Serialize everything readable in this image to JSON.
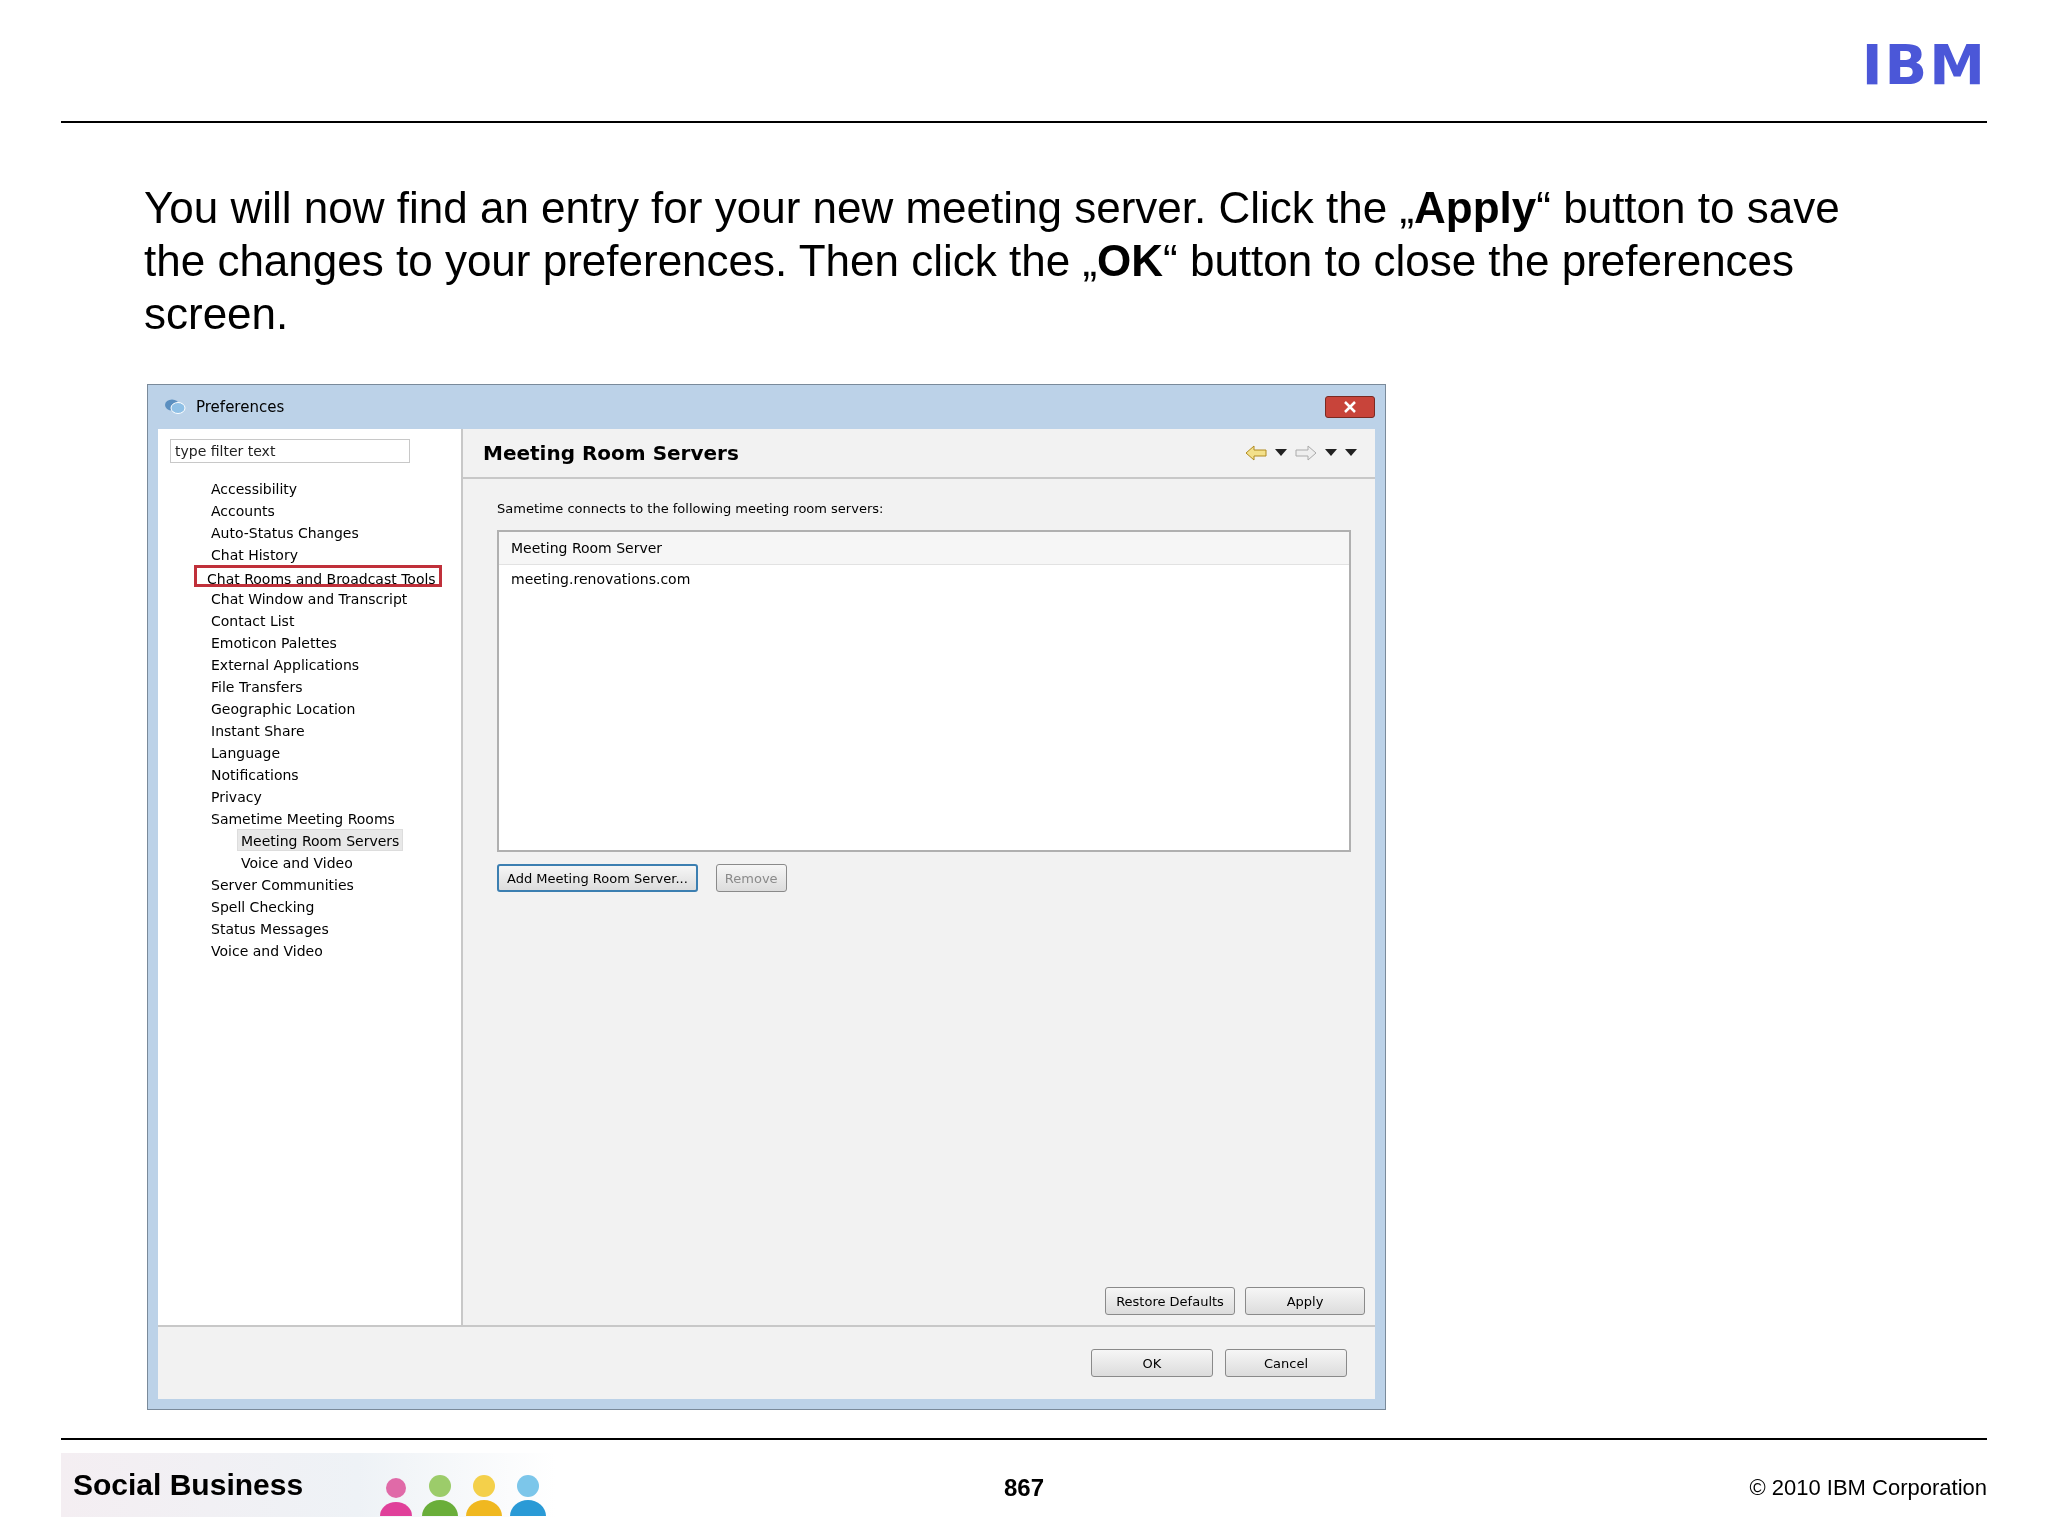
{
  "logo": "IBM",
  "instruction": "You will now find an entry for your new meeting server. Click the „**Apply**“ button to save the changes to your preferences. Then click the „**OK**“ button to close the preferences screen.",
  "dialog": {
    "title": "Preferences",
    "filter": {
      "placeholder": "type filter text"
    },
    "tree": [
      {
        "label": "Accessibility",
        "selected": false,
        "annotated": false
      },
      {
        "label": "Accounts",
        "selected": false,
        "annotated": false
      },
      {
        "label": "Auto-Status Changes",
        "selected": false,
        "annotated": false
      },
      {
        "label": "Chat History",
        "selected": false,
        "annotated": false
      },
      {
        "label": "Chat Rooms and Broadcast Tools",
        "selected": false,
        "annotated": true
      },
      {
        "label": "Chat Window and Transcript",
        "selected": false,
        "annotated": false
      },
      {
        "label": "Contact List",
        "selected": false,
        "annotated": false
      },
      {
        "label": "Emoticon Palettes",
        "selected": false,
        "annotated": false
      },
      {
        "label": "External Applications",
        "selected": false,
        "annotated": false
      },
      {
        "label": "File Transfers",
        "selected": false,
        "annotated": false
      },
      {
        "label": "Geographic Location",
        "selected": false,
        "annotated": false
      },
      {
        "label": "Instant Share",
        "selected": false,
        "annotated": false
      },
      {
        "label": "Language",
        "selected": false,
        "annotated": false
      },
      {
        "label": "Notifications",
        "selected": false,
        "annotated": false
      },
      {
        "label": "Privacy",
        "selected": false,
        "annotated": false
      },
      {
        "label": "Sametime Meeting Rooms",
        "selected": false,
        "annotated": false,
        "children": [
          {
            "label": "Meeting Room Servers",
            "selected": true,
            "annotated": false
          },
          {
            "label": "Voice and Video",
            "selected": false,
            "annotated": false
          }
        ]
      },
      {
        "label": "Server Communities",
        "selected": false,
        "annotated": false
      },
      {
        "label": "Spell Checking",
        "selected": false,
        "annotated": false
      },
      {
        "label": "Status Messages",
        "selected": false,
        "annotated": false
      },
      {
        "label": "Voice and Video",
        "selected": false,
        "annotated": false
      }
    ],
    "page": {
      "title": "Meeting Room Servers",
      "description": "Sametime connects to the following meeting room servers:",
      "table": {
        "columns": [
          "Meeting Room Server"
        ],
        "rows": [
          [
            "meeting.renovations.com"
          ]
        ]
      },
      "buttons": [
        {
          "label": "Add Meeting Room Server...",
          "disabled": false,
          "focused": true
        },
        {
          "label": "Remove",
          "disabled": true,
          "focused": false
        }
      ],
      "page_buttons": [
        "Restore Defaults",
        "Apply"
      ]
    },
    "buttons": [
      "OK",
      "Cancel"
    ]
  },
  "footer": {
    "banner": "Social Business",
    "page_number": "867",
    "copyright": "© 2010 IBM Corporation"
  }
}
